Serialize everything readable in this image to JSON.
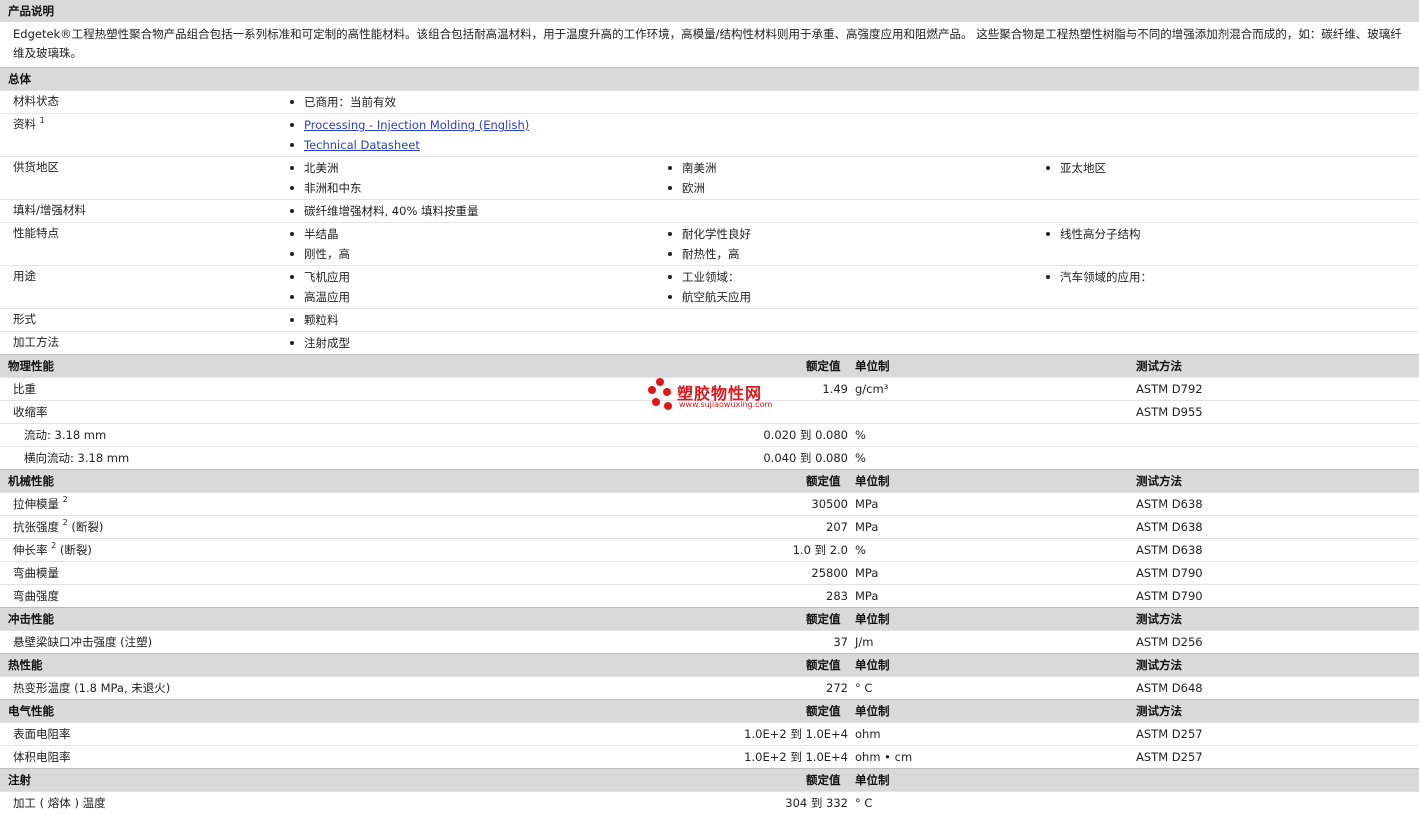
{
  "colors": {
    "header_bg": "#d9d9d9",
    "link": "#2b3fbf",
    "watermark": "#e0161b"
  },
  "product": {
    "header": "产品说明",
    "description": "Edgetek®工程热塑性聚合物产品组合包括一系列标准和可定制的高性能材料。该组合包括耐高温材料，用于温度升高的工作环境，高模量/结构性材料则用于承重、高强度应用和阻燃产品。 这些聚合物是工程热塑性树脂与不同的增强添加剂混合而成的，如：碳纤维、玻璃纤维及玻璃珠。"
  },
  "general": {
    "header": "总体",
    "rows": [
      {
        "label": "材料状态",
        "items": [
          "已商用：当前有效"
        ]
      },
      {
        "label": "资料",
        "sup": "1",
        "items": [
          "Processing - Injection Molding (English)",
          "Technical Datasheet"
        ],
        "links": true
      },
      {
        "label": "供货地区",
        "items": [
          "北美洲",
          "南美洲",
          "亚太地区",
          "非洲和中东",
          "欧洲"
        ]
      },
      {
        "label": "填料/增强材料",
        "items": [
          "碳纤维增强材料, 40% 填料按重量"
        ]
      },
      {
        "label": "性能特点",
        "items": [
          "半结晶",
          "耐化学性良好",
          "线性高分子结构",
          "刚性，高",
          "耐热性，高"
        ]
      },
      {
        "label": "用途",
        "items": [
          "飞机应用",
          "工业领域：",
          "汽车领域的应用：",
          "高温应用",
          "航空航天应用"
        ]
      },
      {
        "label": "形式",
        "items": [
          "颗粒料"
        ]
      },
      {
        "label": "加工方法",
        "items": [
          "注射成型"
        ]
      }
    ]
  },
  "sections": [
    {
      "title": "物理性能",
      "col_value": "额定值",
      "col_unit": "单位制",
      "col_test": "测试方法",
      "rows": [
        {
          "label": "比重",
          "value": "1.49",
          "unit": "g/cm³",
          "test": "ASTM D792"
        },
        {
          "label": "收缩率",
          "value": "",
          "unit": "",
          "test": "ASTM D955"
        },
        {
          "label": "流动: 3.18 mm",
          "sub": true,
          "value": "0.020 到  0.080",
          "unit": "%",
          "test": ""
        },
        {
          "label": "横向流动: 3.18 mm",
          "sub": true,
          "value": "0.040 到  0.080",
          "unit": "%",
          "test": ""
        }
      ]
    },
    {
      "title": "机械性能",
      "col_value": "额定值",
      "col_unit": "单位制",
      "col_test": "测试方法",
      "rows": [
        {
          "label": "拉伸模量",
          "sup": "2",
          "value": "30500",
          "unit": "MPa",
          "test": "ASTM D638"
        },
        {
          "label": "抗张强度",
          "sup": "2",
          "suffix": "(断裂)",
          "value": "207",
          "unit": "MPa",
          "test": "ASTM D638"
        },
        {
          "label": "伸长率",
          "sup": "2",
          "suffix": "(断裂)",
          "value": "1.0 到  2.0",
          "unit": "%",
          "test": "ASTM D638"
        },
        {
          "label": "弯曲模量",
          "value": "25800",
          "unit": "MPa",
          "test": "ASTM D790"
        },
        {
          "label": "弯曲强度",
          "value": "283",
          "unit": "MPa",
          "test": "ASTM D790"
        }
      ]
    },
    {
      "title": "冲击性能",
      "col_value": "额定值",
      "col_unit": "单位制",
      "col_test": "测试方法",
      "rows": [
        {
          "label": "悬壁梁缺口冲击强度 (注塑)",
          "value": "37",
          "unit": "J/m",
          "test": "ASTM D256"
        }
      ]
    },
    {
      "title": "热性能",
      "col_value": "额定值",
      "col_unit": "单位制",
      "col_test": "测试方法",
      "rows": [
        {
          "label": "热变形温度 (1.8 MPa, 未退火)",
          "value": "272",
          "unit": "°  C",
          "test": "ASTM D648"
        }
      ]
    },
    {
      "title": "电气性能",
      "col_value": "额定值",
      "col_unit": "单位制",
      "col_test": "测试方法",
      "rows": [
        {
          "label": "表面电阻率",
          "value": "1.0E+2 到  1.0E+4",
          "unit": "ohm",
          "test": "ASTM D257"
        },
        {
          "label": "体积电阻率",
          "value": "1.0E+2 到  1.0E+4",
          "unit": "ohm • cm",
          "test": "ASTM D257"
        }
      ]
    },
    {
      "title": "注射",
      "col_value": "额定值",
      "col_unit": "单位制",
      "col_test": "",
      "rows": [
        {
          "label": "加工 ( 熔体 ) 温度",
          "value": "304 到  332",
          "unit": "°  C",
          "test": ""
        }
      ]
    }
  ],
  "watermark": {
    "title": "塑胶物性网",
    "url": "www.sujiaowuxing.com"
  }
}
